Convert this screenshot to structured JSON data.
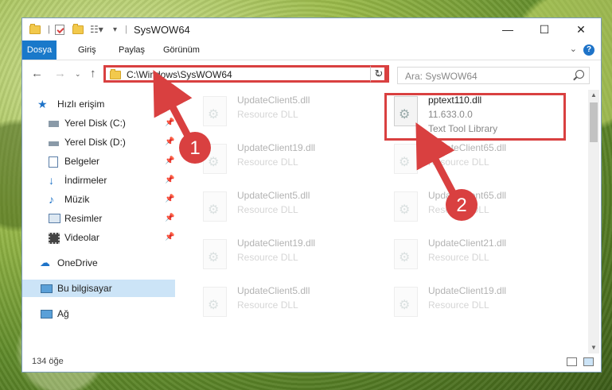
{
  "window": {
    "title": "SysWOW64"
  },
  "ribbon": {
    "tabs": [
      "Dosya",
      "Giriş",
      "Paylaş",
      "Görünüm"
    ]
  },
  "address": {
    "path": "C:\\Windows\\SysWOW64",
    "search_placeholder": "Ara: SysWOW64"
  },
  "nav": {
    "quick_access": "Hızlı erişim",
    "items": [
      {
        "label": "Yerel Disk (C:)",
        "icon": "drive-icon"
      },
      {
        "label": "Yerel Disk (D:)",
        "icon": "drive-icon"
      },
      {
        "label": "Belgeler",
        "icon": "documents-icon"
      },
      {
        "label": "İndirmeler",
        "icon": "downloads-icon"
      },
      {
        "label": "Müzik",
        "icon": "music-icon"
      },
      {
        "label": "Resimler",
        "icon": "pictures-icon"
      },
      {
        "label": "Videolar",
        "icon": "videos-icon"
      }
    ],
    "onedrive": "OneDrive",
    "this_pc": "Bu bilgisayar",
    "network": "Ağ"
  },
  "files": {
    "left": [
      {
        "name": "UpdateClient5.dll",
        "desc": "Resource DLL"
      },
      {
        "name": "UpdateClient19.dll",
        "desc": "Resource DLL"
      },
      {
        "name": "UpdateClient5.dll",
        "desc": "Resource DLL"
      },
      {
        "name": "UpdateClient19.dll",
        "desc": "Resource DLL"
      },
      {
        "name": "UpdateClient5.dll",
        "desc": "Resource DLL"
      }
    ],
    "right": [
      {
        "name": "UpdateClient65.dll",
        "desc": "Resource DLL"
      },
      {
        "name": "UpdateClient65.dll",
        "desc": "Resource DLL"
      },
      {
        "name": "UpdateClient21.dll",
        "desc": "Resource DLL"
      },
      {
        "name": "UpdateClient19.dll",
        "desc": "Resource DLL"
      }
    ],
    "target": {
      "name": "pptext110.dll",
      "version": "11.633.0.0",
      "desc": "Text Tool Library"
    }
  },
  "status": {
    "count": "134 öğe"
  },
  "annotations": {
    "step1": "1",
    "step2": "2",
    "color": "#d94040"
  }
}
